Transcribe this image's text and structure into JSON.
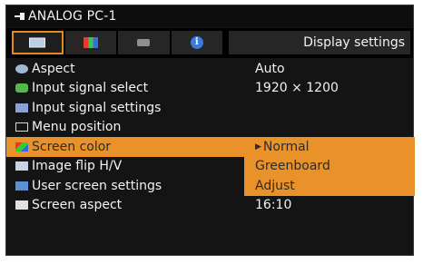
{
  "header": {
    "title": "ANALOG PC-1",
    "page_label": "Display settings",
    "tabs": [
      {
        "icon": "screen-icon",
        "active": true
      },
      {
        "icon": "color-bars-icon",
        "active": false
      },
      {
        "icon": "setup-icon",
        "active": false
      },
      {
        "icon": "info-icon",
        "active": false
      }
    ],
    "info_glyph": "i"
  },
  "menu": {
    "items": [
      {
        "label": "Aspect",
        "value": "Auto",
        "icon": "aspect-icon"
      },
      {
        "label": "Input signal select",
        "value": "1920 × 1200",
        "icon": "signal-icon"
      },
      {
        "label": "Input signal settings",
        "value": "",
        "icon": "signal-settings-icon"
      },
      {
        "label": "Menu position",
        "value": "",
        "icon": "menu-position-icon"
      },
      {
        "label": "Screen color",
        "value": "Normal",
        "icon": "screen-color-icon",
        "selected": true
      },
      {
        "label": "Image flip H/V",
        "value": "Greenboard",
        "icon": "image-flip-icon"
      },
      {
        "label": "User screen settings",
        "value": "Adjust",
        "icon": "user-screen-icon"
      },
      {
        "label": "Screen aspect",
        "value": "16:10",
        "icon": "screen-aspect-icon"
      }
    ],
    "caret": "▶"
  },
  "colors": {
    "highlight": "#e9922a",
    "background": "#141414"
  }
}
